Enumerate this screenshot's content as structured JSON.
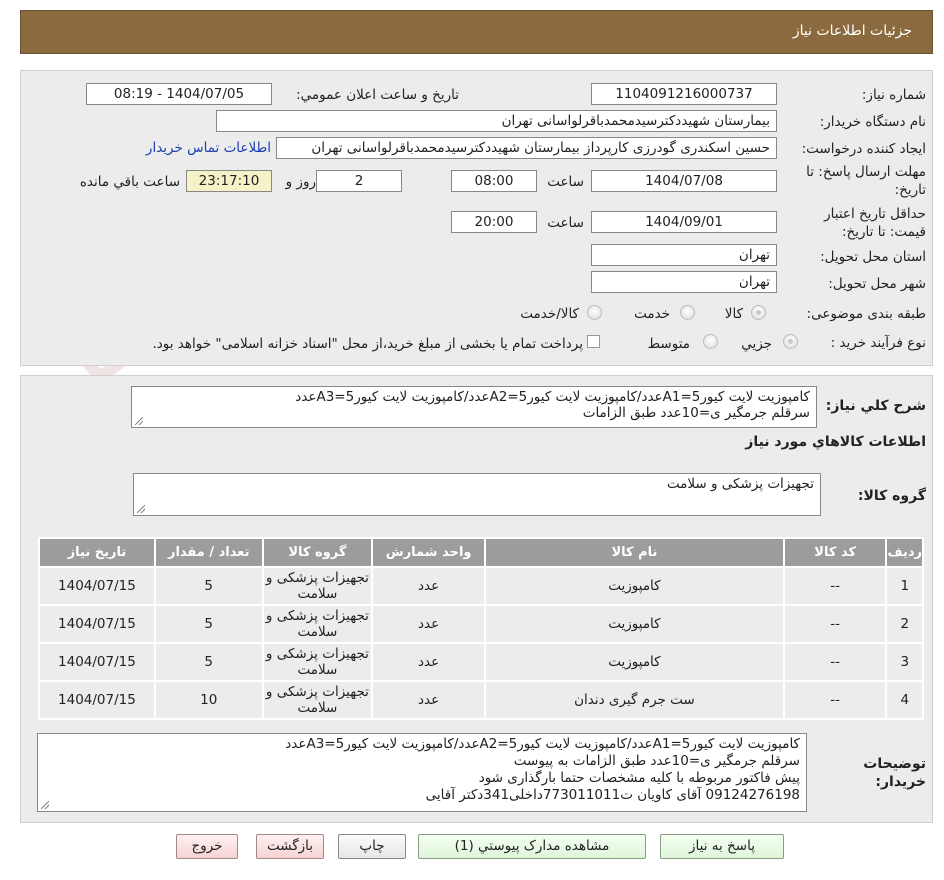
{
  "header": {
    "title": "جزئیات اطلاعات نیاز"
  },
  "form": {
    "need_number_label": "شماره نیاز:",
    "need_number": "1104091216000737",
    "announce_label": "تاریخ و ساعت اعلان عمومي:",
    "announce_value": "1404/07/05 - 08:19",
    "buyer_org_label": "نام دستگاه خریدار:",
    "buyer_org": "بیمارستان شهیددکترسیدمحمدباقرلواسانی تهران",
    "creator_label": "ایجاد کننده درخواست:",
    "creator": "حسین اسکندری گودرزی کارپرداز بیمارستان شهیددکترسیدمحمدباقرلواسانی تهران",
    "contact_link": "اطلاعات تماس خریدار",
    "deadline_label_1": "مهلت ارسال پاسخ: تا",
    "deadline_label_2": "تاریخ:",
    "deadline_date": "1404/07/08",
    "time_label": "ساعت",
    "deadline_time": "08:00",
    "days_value": "2",
    "days_label": "روز و",
    "countdown": "23:17:10",
    "remaining_label": "ساعت باقي مانده",
    "validity_label_1": "حداقل تاریخ اعتبار",
    "validity_label_2": "قیمت: تا تاریخ:",
    "validity_date": "1404/09/01",
    "validity_time": "20:00",
    "province_label": "استان محل تحویل:",
    "province": "تهران",
    "city_label": "شهر محل تحویل:",
    "city": "تهران",
    "category_label": "طبقه بندی موضوعی:",
    "category_options": [
      "کالا",
      "خدمت",
      "کالا/خدمت"
    ],
    "process_label": "نوع فرآیند خرید :",
    "process_options": [
      "جزیي",
      "متوسط"
    ],
    "process_note": "پرداخت تمام یا بخشی از مبلغ خرید،از محل \"اسناد خزانه اسلامی\" خواهد بود."
  },
  "summary": {
    "label": "شرح کلي نیاز:",
    "lines": [
      "کامپوزیت لایت کیور5=A1عدد/کامپوزیت لایت کیور5=A2عدد/کامپوزیت لایت کیور5=A3عدد",
      "سرقلم جرمگیر ی=10عدد طبق الزامات"
    ],
    "goods_info_title": "اطلاعات کالاهاي مورد نیاز",
    "group_label": "گروه کالا:",
    "group_value": "تجهیزات پزشکی و سلامت"
  },
  "table": {
    "headers": [
      "ردیف",
      "کد کالا",
      "نام کالا",
      "واحد شمارش",
      "گروه کالا",
      "تعداد / مقدار",
      "تاریخ نیاز"
    ],
    "rows": [
      {
        "row": "1",
        "code": "--",
        "name": "کامپوزیت",
        "unit": "عدد",
        "group": "تجهیزات پزشکی و سلامت",
        "qty": "5",
        "date": "1404/07/15"
      },
      {
        "row": "2",
        "code": "--",
        "name": "کامپوزیت",
        "unit": "عدد",
        "group": "تجهیزات پزشکی و سلامت",
        "qty": "5",
        "date": "1404/07/15"
      },
      {
        "row": "3",
        "code": "--",
        "name": "کامپوزیت",
        "unit": "عدد",
        "group": "تجهیزات پزشکی و سلامت",
        "qty": "5",
        "date": "1404/07/15"
      },
      {
        "row": "4",
        "code": "--",
        "name": "ست جرم گیری دندان",
        "unit": "عدد",
        "group": "تجهیزات پزشکی و سلامت",
        "qty": "10",
        "date": "1404/07/15"
      }
    ]
  },
  "buyer_notes": {
    "label_1": "توضیحات",
    "label_2": "خریدار:",
    "lines": [
      "کامپوزیت لایت کیور5=A1عدد/کامپوزیت لایت کیور5=A2عدد/کامپوزیت لایت کیور5=A3عدد",
      "سرقلم جرمگیر ی=10عدد طبق الزامات به پیوست",
      "پیش فاکتور مربوطه با کلیه مشخصات حتما بارگذاری شود",
      "09124276198 آقای کاویان ت773011011داخلی341دکتر آقایی"
    ]
  },
  "buttons": {
    "reply": "پاسخ به نیاز",
    "attachments": "مشاهده مدارک پیوستي (1)",
    "print": "چاپ",
    "back": "بازگشت",
    "exit": "خروج"
  },
  "watermark": {
    "text": "AriaTender.neT"
  },
  "colors": {
    "header_bg": "#8b6a3f",
    "panel_bg": "#ececec",
    "table_header_bg": "#9c9c9c",
    "countdown_bg": "#f6f2c8",
    "link": "#1a3fb0"
  }
}
